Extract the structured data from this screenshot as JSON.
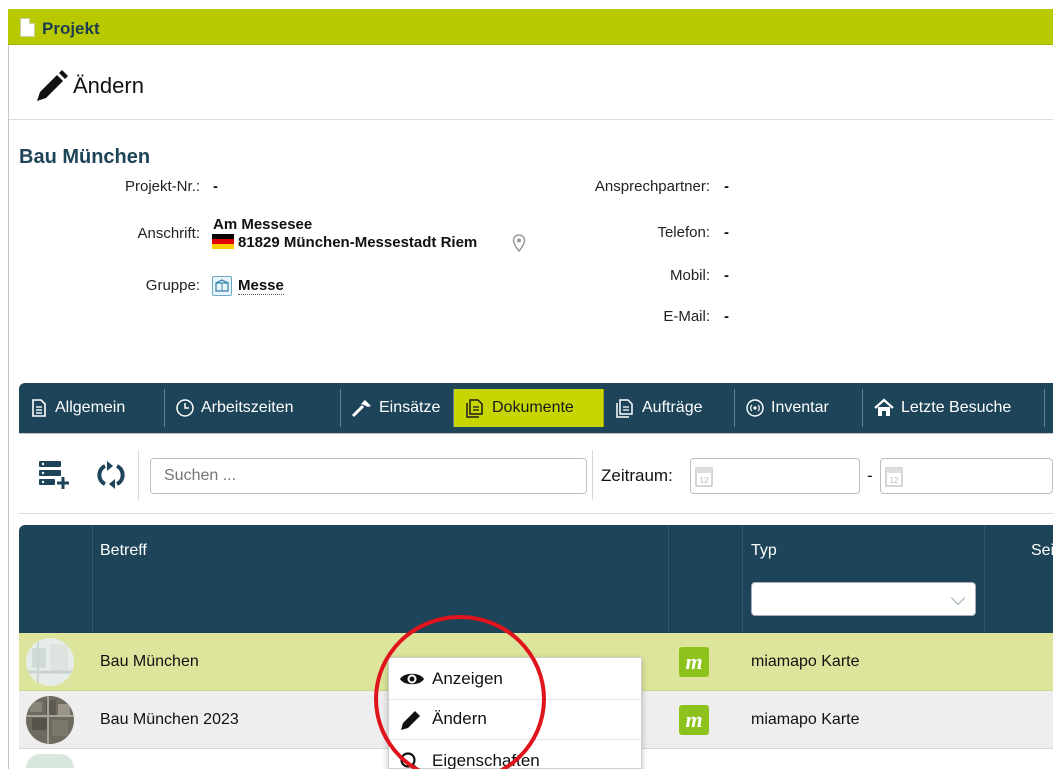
{
  "window": {
    "title": "Projekt"
  },
  "edit_header": {
    "label": "Ändern"
  },
  "project": {
    "name": "Bau München",
    "fields": {
      "projekt_nr_label": "Projekt-Nr.:",
      "projekt_nr_value": "-",
      "anschrift_label": "Anschrift:",
      "address_line1": "Am Messesee",
      "address_line2": "81829 München-Messestadt Riem",
      "gruppe_label": "Gruppe:",
      "gruppe_value": "Messe",
      "ansprechpartner_label": "Ansprechpartner:",
      "ansprechpartner_value": "-",
      "telefon_label": "Telefon:",
      "telefon_value": "-",
      "mobil_label": "Mobil:",
      "mobil_value": "-",
      "email_label": "E-Mail:",
      "email_value": "-"
    },
    "flag_colors": [
      "#000000",
      "#dd0000",
      "#ffce00"
    ]
  },
  "tabs": [
    {
      "label": "Allgemein",
      "icon": "document-icon"
    },
    {
      "label": "Arbeitszeiten",
      "icon": "clock-icon"
    },
    {
      "label": "Einsätze",
      "icon": "hammer-icon"
    },
    {
      "label": "Dokumente",
      "icon": "documents-icon",
      "active": true
    },
    {
      "label": "Aufträge",
      "icon": "orders-icon"
    },
    {
      "label": "Inventar",
      "icon": "inventory-icon"
    },
    {
      "label": "Letzte Besuche",
      "icon": "home-icon"
    }
  ],
  "toolbar": {
    "search_placeholder": "Suchen ...",
    "zeitraum_label": "Zeitraum:",
    "range_separator": "-"
  },
  "table": {
    "columns": {
      "betreff": "Betreff",
      "typ": "Typ",
      "seite": "Seit"
    },
    "typ_filter_value": "",
    "rows": [
      {
        "betreff": "Bau München",
        "typ": "miamapo Karte",
        "badge": "m"
      },
      {
        "betreff": "Bau München 2023",
        "typ": "miamapo Karte",
        "badge": "m"
      }
    ]
  },
  "context_menu": {
    "items": [
      {
        "label": "Anzeigen",
        "icon": "eye-icon"
      },
      {
        "label": "Ändern",
        "icon": "pencil-icon"
      },
      {
        "label": "Eigenschaften",
        "icon": "search-icon"
      }
    ]
  },
  "colors": {
    "title_bar": "#b9c900",
    "dark_navy": "#1d4458",
    "active_tab": "#c7d600",
    "row_highlight": "#dde59c",
    "annotation": "#e0141c"
  }
}
